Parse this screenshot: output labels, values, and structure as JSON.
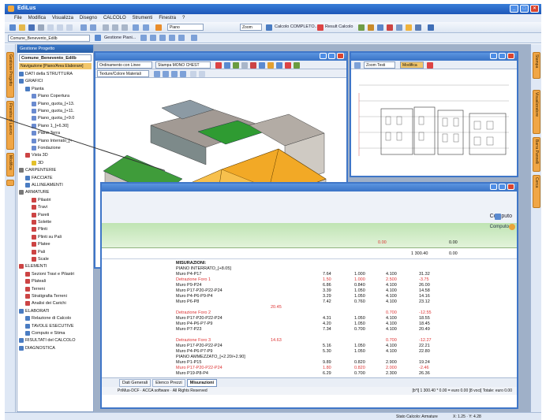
{
  "app": {
    "title": "EdiLus",
    "window_buttons": [
      "_",
      "□",
      "×"
    ]
  },
  "menubar": [
    "File",
    "Modifica",
    "Visualizza",
    "Disegno",
    "CALCOLO",
    "Strumenti",
    "Finestra",
    "?"
  ],
  "toolbar": {
    "items": [
      "Piano",
      "Zoom",
      "Calcolo COMPLETO...",
      "Result Calcolo"
    ]
  },
  "toolbar2": {
    "project_dropdown": "Comune_Benevento_Edilb",
    "gestione_label": "Gestione Piani..."
  },
  "left_panel": {
    "title": "Gestione Progetto",
    "project": "Comune_Benevento_Edilb",
    "nav_label": "Navigazione [Piano/Area Elaborare]",
    "tree": [
      {
        "label": "DATI della STRUTTURA",
        "level": 1,
        "color": "#4a7cc2"
      },
      {
        "label": "GRAFICI",
        "level": 1,
        "color": "#4a7cc2"
      },
      {
        "label": "Pianta",
        "level": 2,
        "color": "#4a7cc2"
      },
      {
        "label": "Piano Copertura",
        "level": 3,
        "color": "#6a8bd0"
      },
      {
        "label": "Piano_quota_[+13.",
        "level": 3,
        "color": "#6a8bd0"
      },
      {
        "label": "Piano_quota_[+11.",
        "level": 3,
        "color": "#6a8bd0"
      },
      {
        "label": "Piano_quota_[+9.0",
        "level": 3,
        "color": "#6a8bd0"
      },
      {
        "label": "Piano 1_[+6.30]",
        "level": 3,
        "color": "#6a8bd0"
      },
      {
        "label": "Piano Terra",
        "level": 3,
        "color": "#6a8bd0"
      },
      {
        "label": "Piano Interrato_[+",
        "level": 3,
        "color": "#6a8bd0"
      },
      {
        "label": "Fondazione",
        "level": 3,
        "color": "#6a8bd0"
      },
      {
        "label": "Vista 3D",
        "level": 2,
        "color": "#c44"
      },
      {
        "label": "3D",
        "level": 3,
        "color": "#e3c02a"
      },
      {
        "label": "CARPENTERIE",
        "level": 1,
        "color": "#777"
      },
      {
        "label": "FACCIATE",
        "level": 2,
        "color": "#4a7cc2"
      },
      {
        "label": "ALLINEAMENTI",
        "level": 2,
        "color": "#4a7cc2"
      },
      {
        "label": "ARMATURE",
        "level": 1,
        "color": "#777"
      },
      {
        "label": "Pilastri",
        "level": 3,
        "color": "#c44"
      },
      {
        "label": "Travi",
        "level": 3,
        "color": "#c44"
      },
      {
        "label": "Pareti",
        "level": 3,
        "color": "#c44"
      },
      {
        "label": "Solette",
        "level": 3,
        "color": "#c44"
      },
      {
        "label": "Plinti",
        "level": 3,
        "color": "#c44"
      },
      {
        "label": "Plinti su Pali",
        "level": 3,
        "color": "#c44"
      },
      {
        "label": "Platee",
        "level": 3,
        "color": "#c44"
      },
      {
        "label": "Pali",
        "level": 3,
        "color": "#c44"
      },
      {
        "label": "Scale",
        "level": 3,
        "color": "#c44"
      },
      {
        "label": "ELEMENTI",
        "level": 1,
        "color": "#c44"
      },
      {
        "label": "Sezioni Travi e Pilastri",
        "level": 2,
        "color": "#c44"
      },
      {
        "label": "Plateali",
        "level": 2,
        "color": "#c44"
      },
      {
        "label": "Terreni",
        "level": 2,
        "color": "#c44"
      },
      {
        "label": "Stratigrafia Terreni",
        "level": 2,
        "color": "#c44"
      },
      {
        "label": "Analisi dei Carichi",
        "level": 2,
        "color": "#c44"
      },
      {
        "label": "ELABORATI",
        "level": 1,
        "color": "#4a7cc2"
      },
      {
        "label": "Relazione di Calcolo",
        "level": 2,
        "color": "#4a7cc2"
      },
      {
        "label": "TAVOLE ESECUTIVE",
        "level": 2,
        "color": "#4a7cc2"
      },
      {
        "label": "Computo e Stima",
        "level": 2,
        "color": "#4a7cc2"
      },
      {
        "label": "RISULTATI del CALCOLO",
        "level": 1,
        "color": "#4a7cc2"
      },
      {
        "label": "DIAGNOSTICA",
        "level": 1,
        "color": "#4a7cc2"
      }
    ]
  },
  "view3d": {
    "dropdown_order": "Ordinamento con Linee",
    "dropdown_style": "Stampa MONO CHEST",
    "dropdown_texture": "Texture/Colore Materiali"
  },
  "drawing": {
    "zoom_label": "Zoom Testi",
    "modifica_label": "Modifica"
  },
  "computo": {
    "title": "Computo",
    "header_label": "Computo",
    "measure_value_left": "0.00",
    "measure_value_right": "0.00",
    "sum_value": "1 300.40",
    "rows": [
      {
        "d": "MISURAZIONI:",
        "a": "",
        "b": "",
        "c": "",
        "e": "",
        "red": false,
        "bold": true
      },
      {
        "d": "PIANO INTERRATO_[+8.05]",
        "a": "",
        "b": "",
        "c": "",
        "e": "",
        "red": false
      },
      {
        "d": "Muro P4-P17",
        "a": "7.64",
        "b": "1.000",
        "c": "4.100",
        "e": "31.32",
        "red": false
      },
      {
        "d": "Detrazione Foro 1",
        "a": "1.50",
        "b": "1.000",
        "c": "2.500",
        "e": "-3.75",
        "red": true
      },
      {
        "d": "Muro P9-P24",
        "a": "6.86",
        "b": "0.840",
        "c": "4.100",
        "e": "26.00",
        "red": false
      },
      {
        "d": "Muro P17-P20-P22-P24",
        "a": "3.39",
        "b": "1.050",
        "c": "4.100",
        "e": "14.58",
        "red": false
      },
      {
        "d": "Muro P4-P6-P9-P4",
        "a": "3.29",
        "b": "1.050",
        "c": "4.100",
        "e": "14.16",
        "red": false
      },
      {
        "d": "Muro P6-P8",
        "a": "7.42",
        "b": "0.760",
        "c": "4.100",
        "e": "23.12",
        "red": false
      },
      {
        "d": "",
        "a": "",
        "b": "",
        "c": "",
        "e": "",
        "red": false
      },
      {
        "d": "Detrazione Foro 2",
        "a": "",
        "b": "",
        "c": "0.700",
        "e": "-12.55",
        "red": true
      },
      {
        "d": "Muro P17-P20-P22-P24",
        "a": "4.31",
        "b": "1.050",
        "c": "4.100",
        "e": "18.55",
        "red": false
      },
      {
        "d": "Muro P4-P6-P7-P9",
        "a": "4.20",
        "b": "1.050",
        "c": "4.100",
        "e": "18.45",
        "red": false
      },
      {
        "d": "Muro P7-P23",
        "a": "7.34",
        "b": "0.700",
        "c": "4.100",
        "e": "20.49",
        "red": false
      },
      {
        "d": "",
        "a": "",
        "b": "",
        "c": "",
        "e": "",
        "red": false
      },
      {
        "d": "Detrazione Foro 3",
        "a": "",
        "b": "",
        "c": "0.700",
        "e": "-12.27",
        "red": true
      },
      {
        "d": "Muro P17-P20-P22-P24",
        "a": "5.16",
        "b": "1.050",
        "c": "4.100",
        "e": "22.21",
        "red": false
      },
      {
        "d": "Muro P4-P6-P7-P9",
        "a": "5.30",
        "b": "1.050",
        "c": "4.100",
        "e": "22.80",
        "red": false
      },
      {
        "d": "PIANO AMMEZZATO_[+2.20/+2.90]",
        "a": "",
        "b": "",
        "c": "",
        "e": "",
        "red": false
      },
      {
        "d": "Muro P1-P15",
        "a": "9.89",
        "b": "0.820",
        "c": "2.900",
        "e": "19.24",
        "red": false
      },
      {
        "d": "Muro P17-P20-P22-P24",
        "a": "1.80",
        "b": "0.820",
        "c": "2.000",
        "e": "-2.46",
        "red": true
      },
      {
        "d": "Muro P19-P8-P4",
        "a": "6.29",
        "b": "0.700",
        "c": "2.300",
        "e": "26.36",
        "red": false
      }
    ],
    "left_col_values": [
      "20.45",
      "14.63"
    ],
    "tabs": [
      "Dati Generali",
      "Elenco Prezzi",
      "Misurazioni"
    ],
    "footer_left": "PriMus-DCF · ACCA software · All Rights Reserved",
    "footer_right": "[b*l] 1 300.40 * 0.00 = euro 0.00  [8 voci]  Totale: euro 0.00"
  },
  "right_strip": [
    "Stampa",
    "Visualizzatore",
    "Barra Pannelli",
    "Cerca"
  ],
  "left_strip": [
    "Gestione Progetto",
    "Finestra di Lavoro",
    "Modifica"
  ],
  "status": {
    "right_text": "Stato Calcolo: Armature",
    "coords": "X: 1.25 · Y: 4.28"
  }
}
